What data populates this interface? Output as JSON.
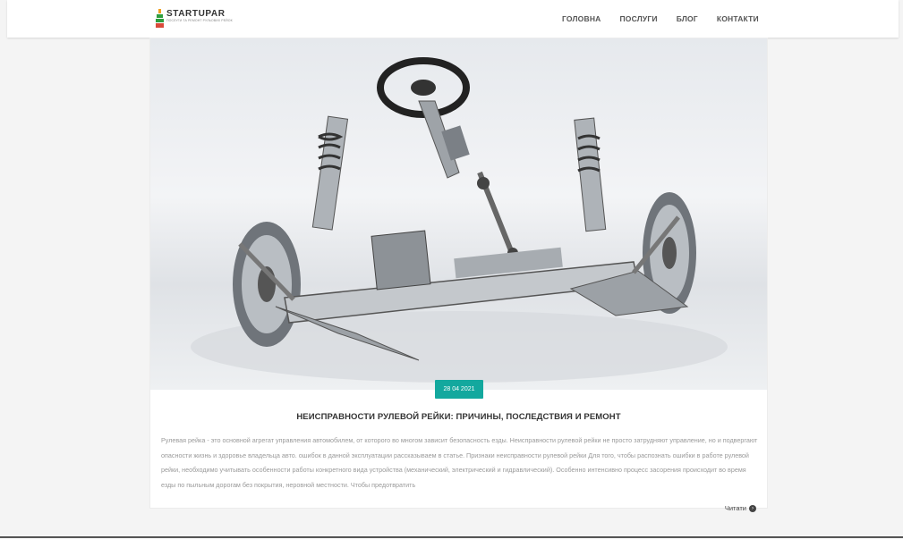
{
  "header": {
    "logo": {
      "name": "STARTUPAR",
      "tagline": "ПОСЛУГИ ТА РЕМОНТ РУЛЬОВИХ РЕЙОК"
    },
    "nav": [
      "ГОЛОВНА",
      "ПОСЛУГИ",
      "БЛОГ",
      "КОНТАКТИ"
    ]
  },
  "post": {
    "image_alt": "steering rack and suspension assembly",
    "date": "28 04 2021",
    "title": "НЕИСПРАВНОСТИ РУЛЕВОЙ РЕЙКИ: ПРИЧИНЫ, ПОСЛЕДСТВИЯ И РЕМОНТ",
    "excerpt": "Рулевая рейка - это основной агрегат управления автомобилем, от которого во многом зависит безопасность езды. Неисправности рулевой рейки не просто затрудняют управление, но и подвергают опасности жизнь и здоровье владельца авто. ошибок в данной эксплуатации рассказываем в статье. Признаки неисправности рулевой рейки Для того, чтобы распознать ошибки в работе рулевой рейки, необходимо учитывать особенности работы конкретного вида устройства (механический, электрический и гидравлический). Особенно интенсивно процесс засорения происходит во время езды по пыльным дорогам без покрытия, неровной местности. Чтобы предотвратить",
    "read_more": "Читати",
    "read_more_icon": "arrow-right-circle-icon"
  },
  "colors": {
    "accent": "#13a89e",
    "logo_green": "#2e9e3e",
    "logo_red": "#d94a3a",
    "logo_orange": "#f0a020"
  }
}
